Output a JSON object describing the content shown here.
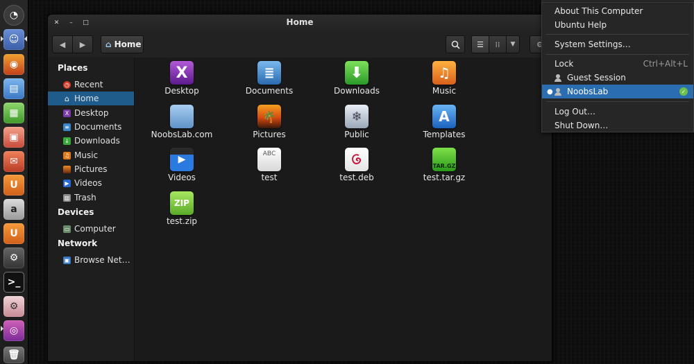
{
  "window": {
    "title": "Home",
    "path_label": "Home"
  },
  "sidebar": {
    "places_header": "Places",
    "places": [
      {
        "label": "Recent",
        "icon": "clock-icon"
      },
      {
        "label": "Home",
        "icon": "home-icon",
        "selected": true
      },
      {
        "label": "Desktop",
        "icon": "desktop-icon"
      },
      {
        "label": "Documents",
        "icon": "documents-icon"
      },
      {
        "label": "Downloads",
        "icon": "downloads-icon"
      },
      {
        "label": "Music",
        "icon": "music-icon"
      },
      {
        "label": "Pictures",
        "icon": "pictures-icon"
      },
      {
        "label": "Videos",
        "icon": "videos-icon"
      },
      {
        "label": "Trash",
        "icon": "trash-icon"
      }
    ],
    "devices_header": "Devices",
    "devices": [
      {
        "label": "Computer",
        "icon": "computer-icon"
      }
    ],
    "network_header": "Network",
    "network": [
      {
        "label": "Browse Net…",
        "icon": "network-icon"
      }
    ]
  },
  "files": [
    {
      "label": "Desktop",
      "icon": "desktop-folder-icon"
    },
    {
      "label": "Documents",
      "icon": "documents-folder-icon"
    },
    {
      "label": "Downloads",
      "icon": "downloads-folder-icon"
    },
    {
      "label": "Music",
      "icon": "music-folder-icon"
    },
    {
      "label": "NoobsLab.com",
      "icon": "folder-icon"
    },
    {
      "label": "Pictures",
      "icon": "pictures-folder-icon"
    },
    {
      "label": "Public",
      "icon": "public-folder-icon"
    },
    {
      "label": "Templates",
      "icon": "templates-folder-icon"
    },
    {
      "label": "Videos",
      "icon": "videos-folder-icon"
    },
    {
      "label": "test",
      "icon": "text-file-icon",
      "glyph": "ABC"
    },
    {
      "label": "test.deb",
      "icon": "deb-package-icon"
    },
    {
      "label": "test.tar.gz",
      "icon": "archive-tar-icon",
      "glyph": "TAR.GZ"
    },
    {
      "label": "test.zip",
      "icon": "archive-zip-icon",
      "glyph": "ZIP"
    }
  ],
  "user_menu": {
    "items": [
      {
        "label": "About This Computer"
      },
      {
        "label": "Ubuntu Help"
      },
      {
        "label": "System Settings…"
      },
      {
        "label": "Lock",
        "accel": "Ctrl+Alt+L"
      },
      {
        "label": "Guest Session"
      },
      {
        "label": "NoobsLab"
      },
      {
        "label": "Log Out…"
      },
      {
        "label": "Shut Down…"
      }
    ]
  },
  "colors": {
    "selection": "#1f5c8c",
    "menu_selection": "#2a6db0",
    "status_available": "#6cc04a"
  }
}
